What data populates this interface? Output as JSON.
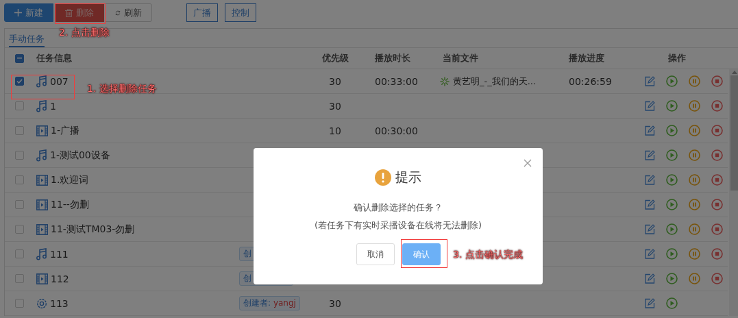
{
  "toolbar": {
    "buttons": [
      {
        "label": "新建",
        "kind": "primary"
      },
      {
        "label": "删除",
        "kind": "danger"
      },
      {
        "label": "刷新",
        "kind": "default"
      }
    ],
    "mode_buttons": [
      "广播",
      "控制"
    ]
  },
  "tabs": [
    {
      "label": "手动任务",
      "selected": true
    }
  ],
  "table": {
    "indeterminate": true,
    "columns": [
      "任务信息",
      "优先级",
      "播放时长",
      "当前文件",
      "播放进度",
      "操作"
    ],
    "rows": [
      {
        "checked": true,
        "kind": "audio",
        "name": "007",
        "priority": "30",
        "duration": "00:33:00",
        "current_file": "黄艺明_-_我们的天...",
        "progress": "00:26:59",
        "actions": [
          {
            "kind": "edit"
          },
          {
            "kind": "play"
          },
          {
            "kind": "pause"
          },
          {
            "kind": "stop"
          }
        ]
      },
      {
        "checked": false,
        "kind": "audio",
        "name": "1",
        "priority": "30",
        "actions": [
          {
            "kind": "edit"
          },
          {
            "kind": "play"
          },
          {
            "kind": "pause"
          },
          {
            "kind": "stop"
          }
        ]
      },
      {
        "checked": false,
        "kind": "video",
        "name": "1-广播",
        "priority": "10",
        "duration": "00:30:00",
        "actions": [
          {
            "kind": "edit"
          },
          {
            "kind": "play"
          },
          {
            "kind": "pause"
          },
          {
            "kind": "stop"
          }
        ]
      },
      {
        "checked": false,
        "kind": "audio",
        "name": "1-测试00设备",
        "actions": [
          {
            "kind": "edit"
          },
          {
            "kind": "play"
          },
          {
            "kind": "pause"
          },
          {
            "kind": "stop"
          }
        ]
      },
      {
        "checked": false,
        "kind": "video",
        "name": "1.欢迎词",
        "actions": [
          {
            "kind": "edit"
          },
          {
            "kind": "play"
          },
          {
            "kind": "pause"
          },
          {
            "kind": "stop"
          }
        ]
      },
      {
        "checked": false,
        "kind": "video",
        "name": "11--勿删",
        "actions": [
          {
            "kind": "edit"
          },
          {
            "kind": "play"
          },
          {
            "kind": "pause"
          },
          {
            "kind": "stop"
          }
        ]
      },
      {
        "checked": false,
        "kind": "video",
        "name": "11-测试TM03-勿删",
        "actions": [
          {
            "kind": "edit"
          },
          {
            "kind": "play"
          },
          {
            "kind": "pause"
          },
          {
            "kind": "stop"
          }
        ]
      },
      {
        "checked": false,
        "kind": "audio",
        "name": "111",
        "tag": {
          "label": "创"
        },
        "actions": [
          {
            "kind": "edit"
          },
          {
            "kind": "play"
          },
          {
            "kind": "pause"
          },
          {
            "kind": "stop"
          }
        ]
      },
      {
        "checked": false,
        "kind": "video",
        "name": "112",
        "tag": {
          "label": "创"
        },
        "actions": [
          {
            "kind": "edit"
          },
          {
            "kind": "play"
          },
          {
            "kind": "pause"
          },
          {
            "kind": "stop"
          }
        ]
      },
      {
        "checked": false,
        "kind": "settings",
        "name": "113",
        "tag": {
          "label": "创建者:",
          "value": "yangj"
        },
        "priority": "30",
        "actions": [
          {
            "kind": "edit"
          },
          {
            "kind": "play"
          }
        ]
      }
    ]
  },
  "dialog": {
    "title": "提示",
    "message": "确认删除选择的任务？",
    "note": "(若任务下有实时采播设备在线将无法删除)",
    "buttons": [
      {
        "label": "取消",
        "kind": "default"
      },
      {
        "label": "确认",
        "kind": "primary"
      }
    ]
  },
  "annotations": [
    "2. 点击删除",
    "1. 选择删除任务",
    "3. 点击确认完成"
  ]
}
